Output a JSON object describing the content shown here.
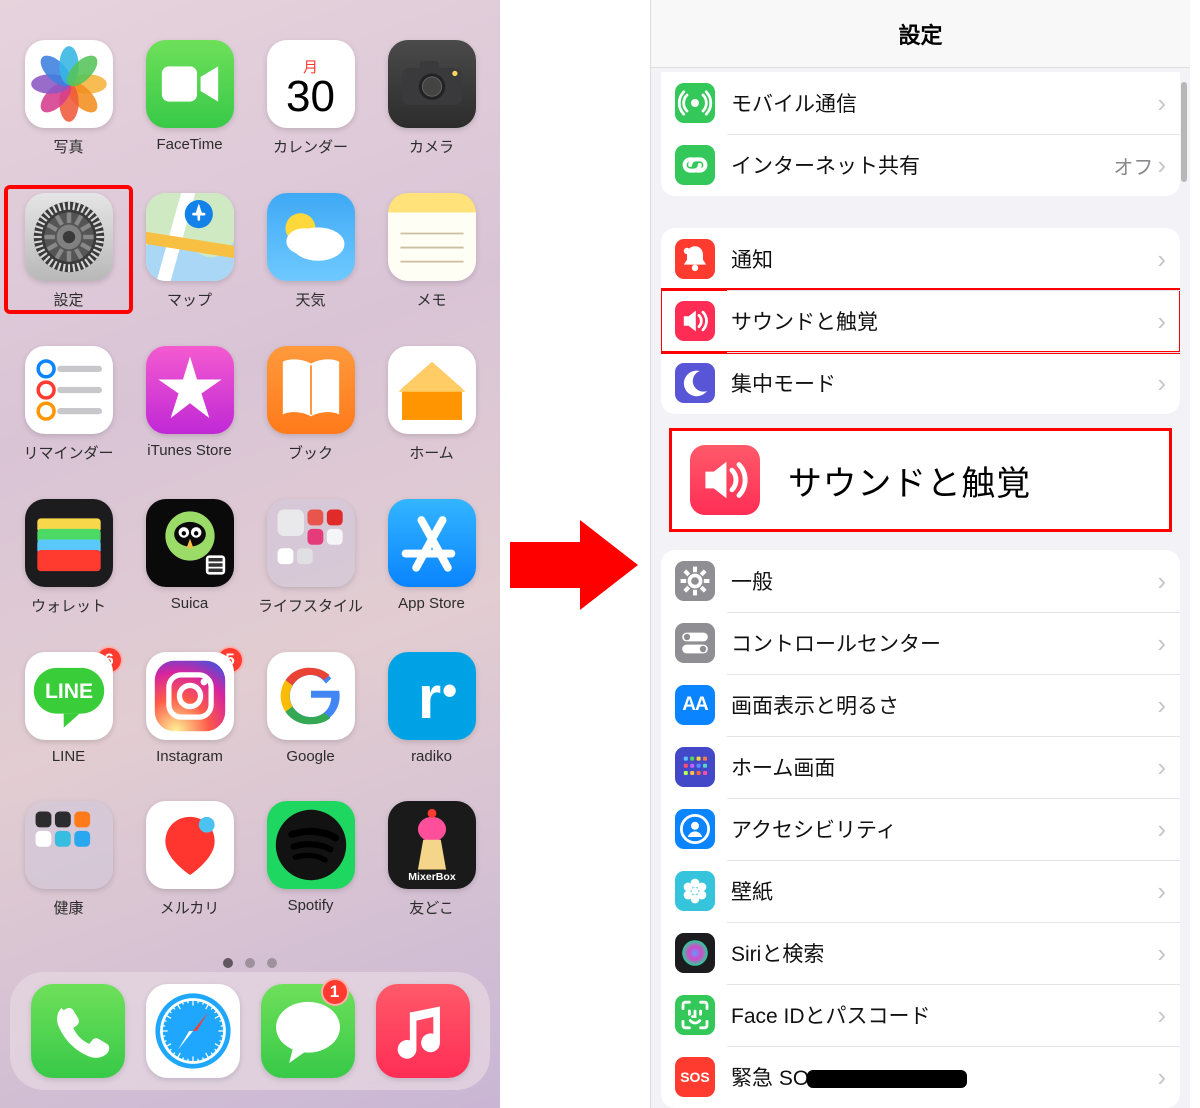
{
  "homescreen": {
    "calendar_day_label": "月",
    "calendar_day_number": "30",
    "apps": [
      {
        "label": "写真",
        "name": "photos-app",
        "bg": "#fff"
      },
      {
        "label": "FaceTime",
        "name": "facetime-app",
        "bg": "linear-gradient(180deg,#6ee05a,#38c948)"
      },
      {
        "label": "カレンダー",
        "name": "calendar-app",
        "bg": "#fff"
      },
      {
        "label": "カメラ",
        "name": "camera-app",
        "bg": "linear-gradient(180deg,#4a4a4a,#2c2c2c)"
      },
      {
        "label": "設定",
        "name": "settings-app",
        "bg": "linear-gradient(180deg,#e5e5e5,#b8b8b8)",
        "highlight": true
      },
      {
        "label": "マップ",
        "name": "maps-app",
        "bg": "#fff"
      },
      {
        "label": "天気",
        "name": "weather-app",
        "bg": "linear-gradient(180deg,#3fa9f5,#6fc9ff)"
      },
      {
        "label": "メモ",
        "name": "notes-app",
        "bg": "linear-gradient(180deg,#ffe27a 22%,#fffef5 22%)"
      },
      {
        "label": "リマインダー",
        "name": "reminders-app",
        "bg": "#fff"
      },
      {
        "label": "iTunes Store",
        "name": "itunes-store-app",
        "bg": "linear-gradient(180deg,#f45bd0,#c028d6)"
      },
      {
        "label": "ブック",
        "name": "books-app",
        "bg": "linear-gradient(180deg,#ff9a3c,#ff7a1a)"
      },
      {
        "label": "ホーム",
        "name": "home-app",
        "bg": "#fff"
      },
      {
        "label": "ウォレット",
        "name": "wallet-app",
        "bg": "#1c1c1e"
      },
      {
        "label": "Suica",
        "name": "suica-app",
        "bg": "#0a0a0a"
      },
      {
        "label": "ライフスタイル",
        "name": "lifestyle-folder",
        "bg": "rgba(210,200,215,.72)"
      },
      {
        "label": "App Store",
        "name": "appstore-app",
        "bg": "linear-gradient(180deg,#33b5ff,#0a84ff)"
      },
      {
        "label": "LINE",
        "name": "line-app",
        "bg": "#fff",
        "badge": "6"
      },
      {
        "label": "Instagram",
        "name": "instagram-app",
        "bg": "#fff",
        "badge": "5"
      },
      {
        "label": "Google",
        "name": "google-app",
        "bg": "#fff"
      },
      {
        "label": "radiko",
        "name": "radiko-app",
        "bg": "#00a2e6"
      },
      {
        "label": "健康",
        "name": "health-folder",
        "bg": "rgba(210,200,215,.72)"
      },
      {
        "label": "メルカリ",
        "name": "mercari-app",
        "bg": "#fff"
      },
      {
        "label": "Spotify",
        "name": "spotify-app",
        "bg": "#1ed760"
      },
      {
        "label": "友どこ",
        "name": "mixerbox-app",
        "bg": "#1a1a1a",
        "sub": "MixerBox"
      }
    ],
    "dock": [
      {
        "name": "phone-app",
        "bg": "linear-gradient(180deg,#6ee05a,#38c948)"
      },
      {
        "name": "safari-app",
        "bg": "#fff"
      },
      {
        "name": "messages-app",
        "bg": "linear-gradient(180deg,#6ee05a,#38c948)",
        "badge": "1"
      },
      {
        "name": "music-app",
        "bg": "linear-gradient(180deg,#ff5a6a,#ff2d55)"
      }
    ]
  },
  "settings": {
    "title": "設定",
    "groups": [
      [
        {
          "name": "cellular-row",
          "icon_bg": "#34c759",
          "label": "モバイル通信"
        },
        {
          "name": "hotspot-row",
          "icon_bg": "#34c759",
          "label": "インターネット共有",
          "value": "オフ"
        }
      ],
      [
        {
          "name": "notifications-row",
          "icon_bg": "#ff3b30",
          "label": "通知"
        },
        {
          "name": "sounds-row",
          "icon_bg": "#ff2d55",
          "label": "サウンドと触覚",
          "highlight": true
        },
        {
          "name": "focus-row",
          "icon_bg": "#5856d6",
          "label": "集中モード"
        }
      ],
      [
        {
          "name": "general-row",
          "icon_bg": "#8e8e93",
          "label": "一般"
        },
        {
          "name": "control-center-row",
          "icon_bg": "#8e8e93",
          "label": "コントロールセンター"
        },
        {
          "name": "display-row",
          "icon_bg": "#0a84ff",
          "label": "画面表示と明るさ"
        },
        {
          "name": "home-screen-row",
          "icon_bg": "#4348c8",
          "label": "ホーム画面"
        },
        {
          "name": "accessibility-row",
          "icon_bg": "#0a84ff",
          "label": "アクセシビリティ"
        },
        {
          "name": "wallpaper-row",
          "icon_bg": "#35c4dc",
          "label": "壁紙"
        },
        {
          "name": "siri-row",
          "icon_bg": "#1c1c1e",
          "label": "Siriと検索"
        },
        {
          "name": "faceid-row",
          "icon_bg": "#34c759",
          "label": "Face IDとパスコード"
        },
        {
          "name": "sos-row",
          "icon_bg": "#ff3b30",
          "label": "緊急 SOS",
          "redacted": true
        }
      ]
    ],
    "callout_label": "サウンドと触覚"
  }
}
